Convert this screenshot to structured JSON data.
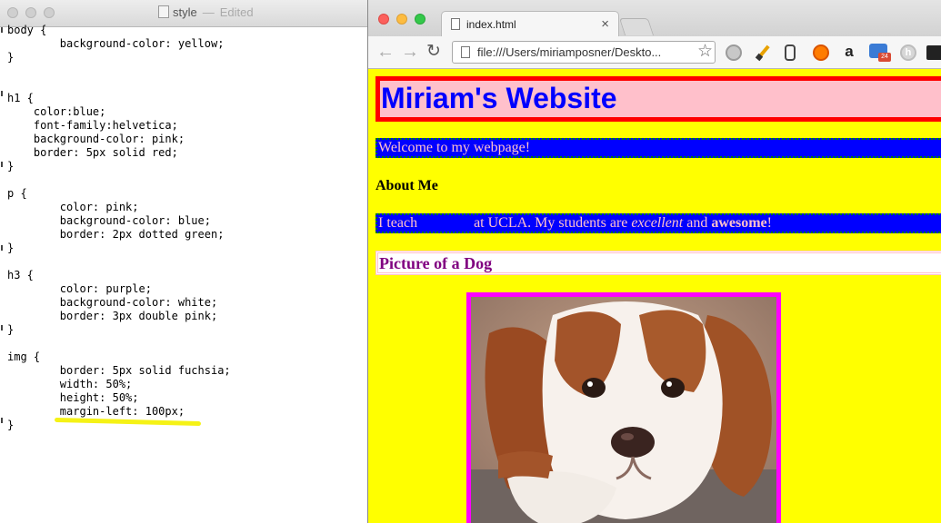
{
  "editor": {
    "title": "style",
    "status": "Edited",
    "code": "body {\n        background-color: yellow;\n}\n\n\nh1 {\n    color:blue;\n    font-family:helvetica;\n    background-color: pink;\n    border: 5px solid red;\n}\n\np {\n        color: pink;\n        background-color: blue;\n        border: 2px dotted green;\n}\n\nh3 {\n        color: purple;\n        background-color: white;\n        border: 3px double pink;\n}\n\nimg {\n        border: 5px solid fuchsia;\n        width: 50%;\n        height: 50%;\n        margin-left: 100px;\n}",
    "highlight_color": "#f5f216"
  },
  "browser": {
    "tab_title": "index.html",
    "tab_close": "×",
    "url": "file:///Users/miriamposner/Deskto...",
    "back": "←",
    "forward": "→",
    "reload": "↻",
    "star": "☆",
    "extensions": [
      "record-icon",
      "pen-icon",
      "evernote-icon",
      "firefox-icon",
      "amazon-icon",
      "calendar-icon",
      "h-icon",
      "screen-icon"
    ],
    "ext_amazon_glyph": "a",
    "ext_badge": "24",
    "ext_h_glyph": "h"
  },
  "page": {
    "h1": "Miriam's Website",
    "welcome": "Welcome to my webpage!",
    "about_heading": "About Me",
    "teach_before": "I teach",
    "teach_middle": "at UCLA. My students are",
    "teach_em": "excellent",
    "teach_and": "and",
    "teach_strong": "awesome",
    "teach_end": "!",
    "h3": "Picture of a Dog",
    "colors": {
      "body_bg": "yellow",
      "h1_color": "blue",
      "h1_bg": "pink",
      "h1_border": "red",
      "p_color": "pink",
      "p_bg": "blue",
      "p_border": "green",
      "h3_color": "purple",
      "h3_bg": "white",
      "img_border": "fuchsia"
    },
    "image_subject": "puppy-photo"
  }
}
